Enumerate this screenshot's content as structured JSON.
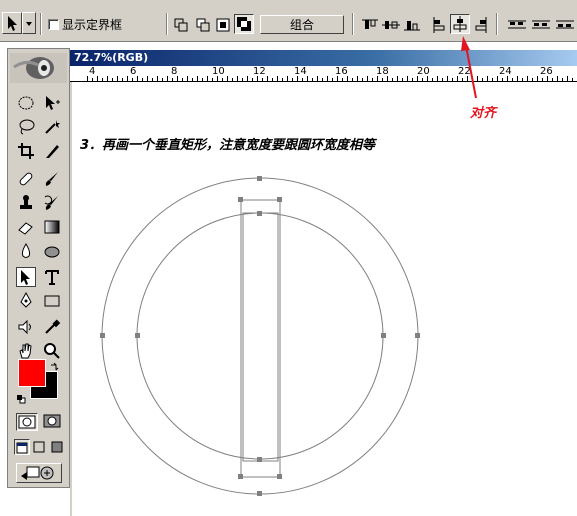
{
  "options_bar": {
    "show_bbox_label": "显示定界框",
    "combine_label": "组合"
  },
  "document": {
    "title": "72.7%(RGB)"
  },
  "ruler": {
    "labels": [
      "4",
      "6",
      "8",
      "10",
      "12",
      "14",
      "16",
      "18",
      "20",
      "22",
      "24",
      "26"
    ]
  },
  "canvas": {
    "instruction": "3．再画一个垂直矩形，注意宽度要跟圆环宽度相等"
  },
  "annotation": {
    "label": "对齐",
    "color": "#e4141e"
  },
  "toolbox": {
    "foreground_color": "#ff0000",
    "background_color": "#000000"
  }
}
